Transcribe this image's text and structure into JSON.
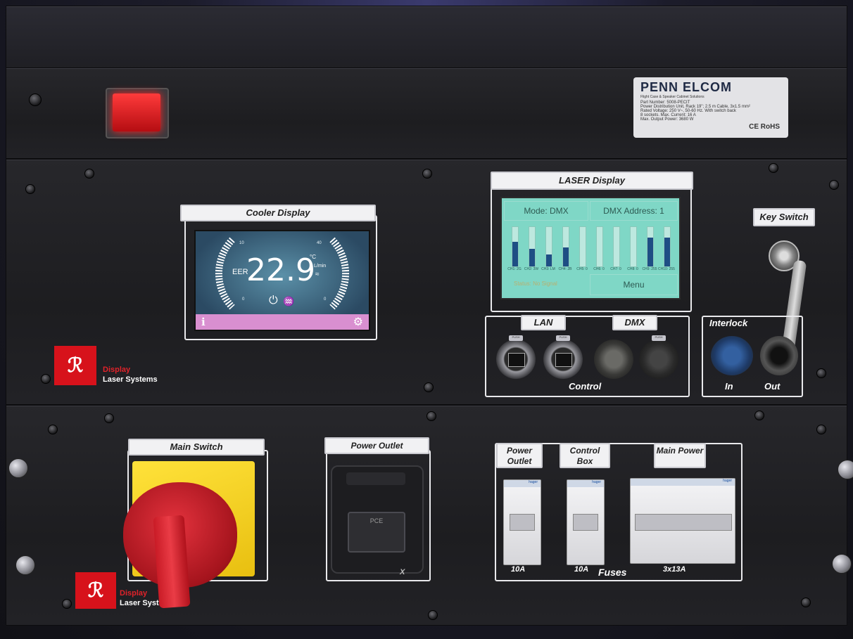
{
  "pdu": {
    "brand": "PENN ELCOM",
    "tagline": "Flight Case & Speaker Cabinet Solutions",
    "lines": [
      "Part Number: 5008-PECIT",
      "Power Distribution Unit, Rack 19\"; 2.5 m Cable, 3x1.5 mm²",
      "Rated Voltage: 250 V~, 50-60 Hz. With switch back",
      "8 sockets. Max. Current: 16 A",
      "Max. Output Power: 3680 W"
    ],
    "marks": "CE RoHS"
  },
  "cooler": {
    "label": "Cooler Display",
    "value": "22.9",
    "eer": "EER",
    "left_scale_max": "10",
    "left_scale_min": "0",
    "right_scale_max": "40",
    "right_scale_min": "0",
    "unit_temp": "°C",
    "unit_flow": "L/min",
    "flow_symbol": "≈",
    "power_symbol": "⏻",
    "water_symbol": "♒",
    "info_symbol": "ℹ",
    "settings_symbol": "⚙"
  },
  "laser": {
    "label": "LASER Display",
    "mode": "Mode: DMX",
    "address": "DMX Address: 1",
    "status": "Status: No Signal",
    "menu": "Menu",
    "channels": [
      {
        "name": "CH1: 2G",
        "level": 0.62
      },
      {
        "name": "CH2: 3W",
        "level": 0.45
      },
      {
        "name": "CH3: LM",
        "level": 0.3
      },
      {
        "name": "CH4: 2B",
        "level": 0.48
      },
      {
        "name": "CH5: 0",
        "level": 0.0
      },
      {
        "name": "CH6: 0",
        "level": 0.0
      },
      {
        "name": "CH7: 0",
        "level": 0.0
      },
      {
        "name": "CH8: 0",
        "level": 0.0
      },
      {
        "name": "CH9: 255",
        "level": 0.74
      },
      {
        "name": "CH10: 255",
        "level": 0.74
      }
    ]
  },
  "key_switch": {
    "label": "Key Switch"
  },
  "control": {
    "lan_label": "LAN",
    "dmx_label": "DMX",
    "footer": "Control",
    "port_tab": "PUSH"
  },
  "interlock": {
    "label": "Interlock",
    "in": "In",
    "out": "Out"
  },
  "brand": {
    "mark": "ℛ",
    "line1": "Display",
    "line2": "Laser Systems",
    "line2_short": "Laser Syst"
  },
  "main_switch": {
    "label": "Main Switch"
  },
  "power_outlet": {
    "label": "Power Outlet",
    "socket_text": "PCE",
    "rating_suffix": "X"
  },
  "fuses": {
    "title": "Fuses",
    "columns": [
      {
        "label": "Power Outlet",
        "rating": "10A"
      },
      {
        "label": "Control Box",
        "rating": "10A"
      },
      {
        "label": "Main Power",
        "rating": "3x13A"
      }
    ],
    "breaker_brand": "hager"
  }
}
